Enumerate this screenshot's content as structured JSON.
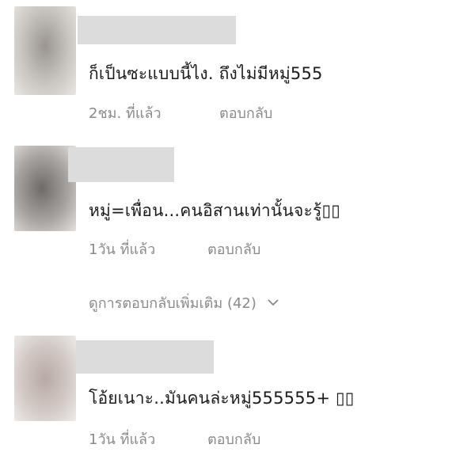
{
  "comments": [
    {
      "text": "ก็เป็นซะแบบนี้ไง. ถึงไม่มีหมู่555",
      "time": "2ชม. ที่แล้ว",
      "reply_label": "ตอบกลับ"
    },
    {
      "text": "หมู่=เพื่อน...คนอิสานเท่านั้นจะรู้▯▯",
      "time": "1วัน ที่แล้ว",
      "reply_label": "ตอบกลับ",
      "more_replies_label": "ดูการตอบกลับเพิ่มเติม (42)"
    },
    {
      "text": "โอ้ยเนาะ..มันคนล่ะหมู่555555+ ▯▯",
      "time": "1วัน ที่แล้ว",
      "reply_label": "ตอบกลับ"
    }
  ],
  "colors": {
    "text": "#1b1b1b",
    "meta": "#8a8a8a",
    "placeholder": "#dcdcdc"
  }
}
